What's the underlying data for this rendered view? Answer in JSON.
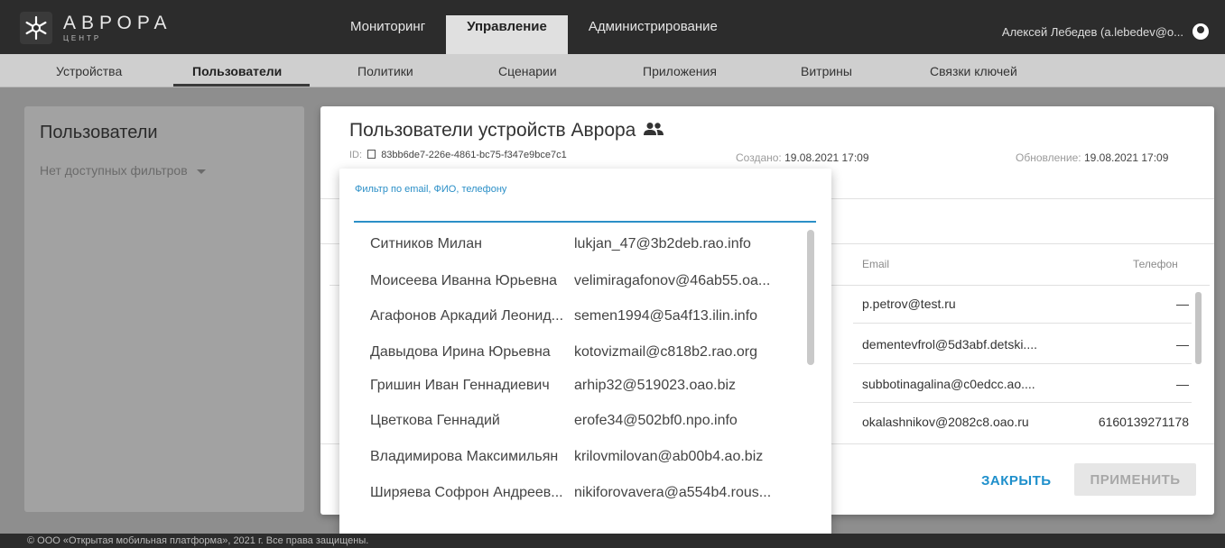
{
  "brand": {
    "name": "АВРОРА",
    "sub": "ЦЕНТР"
  },
  "main_tabs": [
    {
      "label": "Мониторинг"
    },
    {
      "label": "Управление"
    },
    {
      "label": "Администрирование"
    }
  ],
  "user": {
    "name": "Алексей Лебедев (a.lebedev@o...",
    "icon": "account-circle-icon"
  },
  "sub_nav": [
    {
      "label": "Устройства"
    },
    {
      "label": "Пользователи"
    },
    {
      "label": "Политики"
    },
    {
      "label": "Сценарии"
    },
    {
      "label": "Приложения"
    },
    {
      "label": "Витрины"
    },
    {
      "label": "Связки ключей"
    }
  ],
  "left_panel": {
    "title": "Пользователи",
    "filter": "Нет доступных фильтров"
  },
  "dialog": {
    "title": "Пользователи устройств Аврора",
    "id_label": "ID:",
    "id_value": "83bb6de7-226e-4861-bc75-f347e9bce7c1",
    "created_label": "Создано:",
    "created_value": "19.08.2021 17:09",
    "updated_label": "Обновление:",
    "updated_value": "19.08.2021 17:09",
    "columns": {
      "email": "Email",
      "phone": "Телефон"
    },
    "rows": [
      {
        "email": "p.petrov@test.ru",
        "phone": "—"
      },
      {
        "email": "dementevfrol@5d3abf.detski....",
        "phone": "—"
      },
      {
        "email": "subbotinagalina@c0edcc.ao....",
        "phone": "—"
      },
      {
        "email": "okalashnikov@2082c8.oao.ru",
        "phone": "6160139271178"
      }
    ],
    "close_label": "ЗАКРЫТЬ",
    "apply_label": "ПРИМЕНИТЬ"
  },
  "popup": {
    "filter_label": "Фильтр по email, ФИО, телефону",
    "items": [
      {
        "name": "Ситников Милан",
        "email": "lukjan_47@3b2deb.rao.info"
      },
      {
        "name": "Моисеева Иванна Юрьевна",
        "email": "velimiragafonov@46ab55.oa..."
      },
      {
        "name": "Агафонов Аркадий Леонид...",
        "email": "semen1994@5a4f13.ilin.info"
      },
      {
        "name": "Давыдова Ирина Юрьевна",
        "email": "kotovizmail@c818b2.rao.org"
      },
      {
        "name": "Гришин Иван Геннадиевич",
        "email": "arhip32@519023.oao.biz"
      },
      {
        "name": "Цветкова Геннадий",
        "email": "erofe34@502bf0.npo.info"
      },
      {
        "name": "Владимирова Максимильян",
        "email": "krilovmilovan@ab00b4.ao.biz"
      },
      {
        "name": "Ширяева Софрон Андреев...",
        "email": "nikiforovavera@a554b4.rous..."
      }
    ]
  },
  "footer": {
    "text": "© ООО «Открытая мобильная платформа», 2021 г. Все права защищены."
  },
  "colors": {
    "accent": "#2b8fc7",
    "topbar": "#2c2c2c"
  }
}
